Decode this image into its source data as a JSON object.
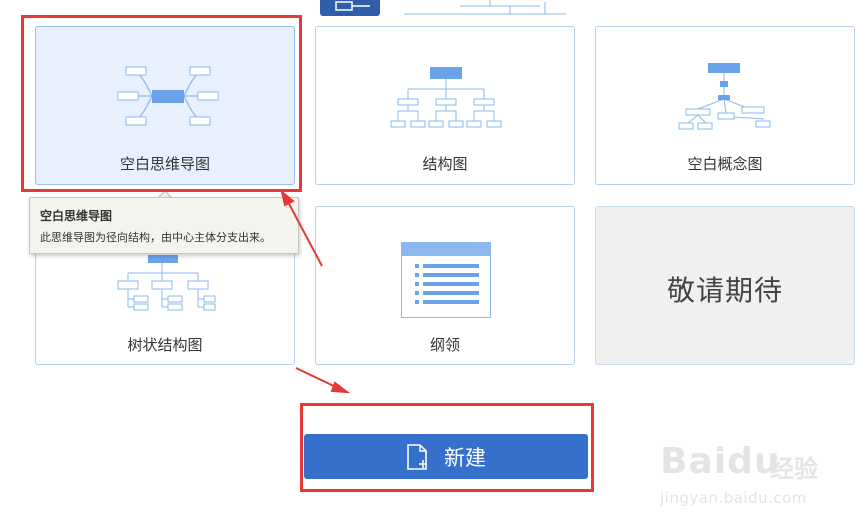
{
  "templates": [
    {
      "id": "blank-mindmap",
      "label": "空白思维导图",
      "selected": true
    },
    {
      "id": "structure",
      "label": "结构图"
    },
    {
      "id": "blank-concept",
      "label": "空白概念图"
    },
    {
      "id": "tree",
      "label": "树状结构图"
    },
    {
      "id": "outline",
      "label": "纲领"
    },
    {
      "id": "coming-soon",
      "label": "敬请期待"
    }
  ],
  "tooltip": {
    "title": "空白思维导图",
    "description": "此思维导图为径向结构，由中心主体分支出来。"
  },
  "new_button": {
    "label": "新建"
  },
  "watermark": {
    "logo": "Baidu",
    "brand": "经验",
    "url": "jingyan.baidu.com"
  },
  "colors": {
    "accent": "#3470cc",
    "diagram": "#8bb8ee",
    "annotation_red": "#e63838",
    "selected_bg": "#e7f0fc"
  }
}
